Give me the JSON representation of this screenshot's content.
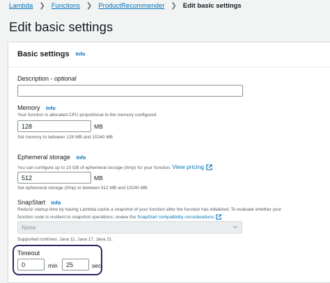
{
  "breadcrumb": {
    "items": [
      "Lambda",
      "Functions",
      "ProductRecommender"
    ],
    "current": "Edit basic settings"
  },
  "page": {
    "title": "Edit basic settings"
  },
  "card": {
    "title": "Basic settings",
    "info": "Info"
  },
  "description": {
    "label": "Description",
    "optional": "optional",
    "separator": " - ",
    "value": ""
  },
  "memory": {
    "label": "Memory",
    "info": "Info",
    "help": "Your function is allocated CPU proportional to the memory configured.",
    "value": "128",
    "unit": "MB",
    "constraint": "Set memory to between 128 MB and 10240 MB"
  },
  "ephemeral": {
    "label": "Ephemeral storage",
    "info": "Info",
    "help": "You can configure up to 10 GB of ephemeral storage (/tmp) for your function.",
    "link": "View pricing",
    "value": "512",
    "unit": "MB",
    "constraint": "Set ephemeral storage (/tmp) to between 512 MB and 10240 MB."
  },
  "snapstart": {
    "label": "SnapStart",
    "info": "Info",
    "help_line1": "Reduce startup time by having Lambda cache a snapshot of your function after the function has initialized. To evaluate whether your",
    "help_line2": "function code is resilient to snapshot operations, review the",
    "link": "SnapStart compatibility considerations",
    "selected": "None",
    "runtimes": "Supported runtimes: Java 11, Java 17, Java 21."
  },
  "timeout": {
    "label": "Timeout",
    "min_value": "0",
    "min_unit": "min",
    "sec_value": "25",
    "sec_unit": "sec"
  },
  "colors": {
    "link": "#0073bb",
    "highlight": "#2e2460",
    "background": "#f2f3f3"
  }
}
